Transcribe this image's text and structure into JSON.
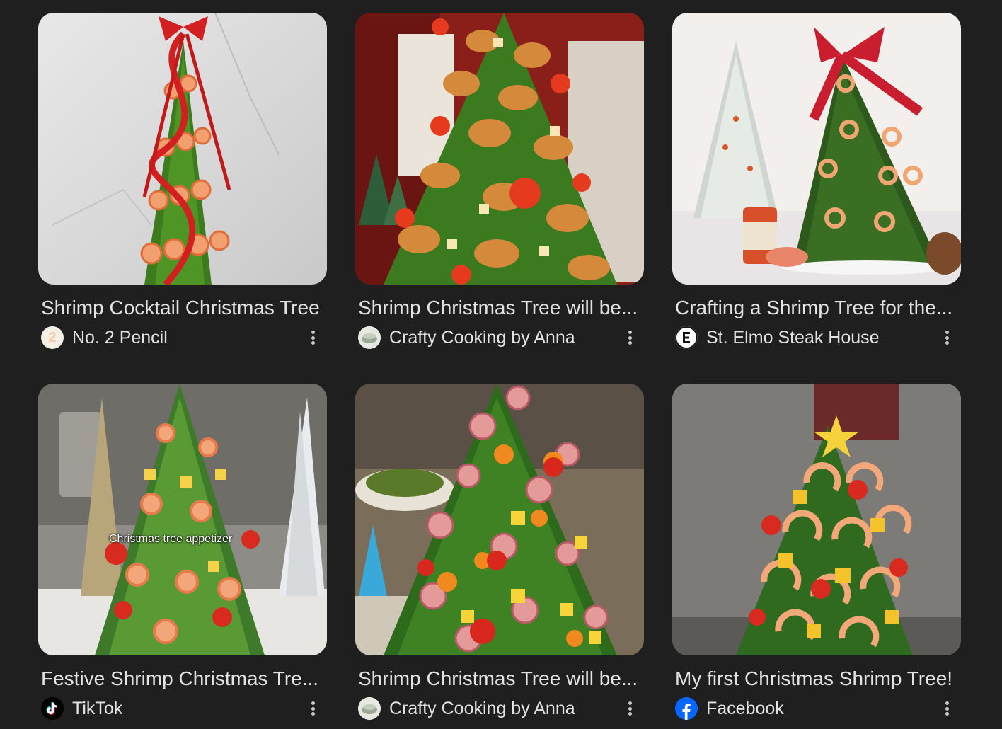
{
  "results": [
    {
      "title": "Shrimp Cocktail Christmas Tree",
      "source": "No. 2 Pencil",
      "favicon": "pencil-2-icon"
    },
    {
      "title": "Shrimp Christmas Tree will be...",
      "source": "Crafty Cooking by Anna",
      "favicon": "crafty-cooking-icon"
    },
    {
      "title": "Crafting a Shrimp Tree for the...",
      "source": "St. Elmo Steak House",
      "favicon": "st-elmo-icon"
    },
    {
      "title": "Festive Shrimp Christmas Tre...",
      "source": "TikTok",
      "favicon": "tiktok-icon",
      "image_caption": "Christmas tree appetizer"
    },
    {
      "title": "Shrimp Christmas Tree will be...",
      "source": "Crafty Cooking by Anna",
      "favicon": "crafty-cooking-icon"
    },
    {
      "title": "My first Christmas Shrimp Tree!",
      "source": "Facebook",
      "favicon": "facebook-icon"
    }
  ],
  "favicons": {
    "pencil-2-text": "2"
  },
  "colors": {
    "background": "#1f1f1f",
    "text": "#e3e3e3",
    "facebook": "#0866ff"
  }
}
